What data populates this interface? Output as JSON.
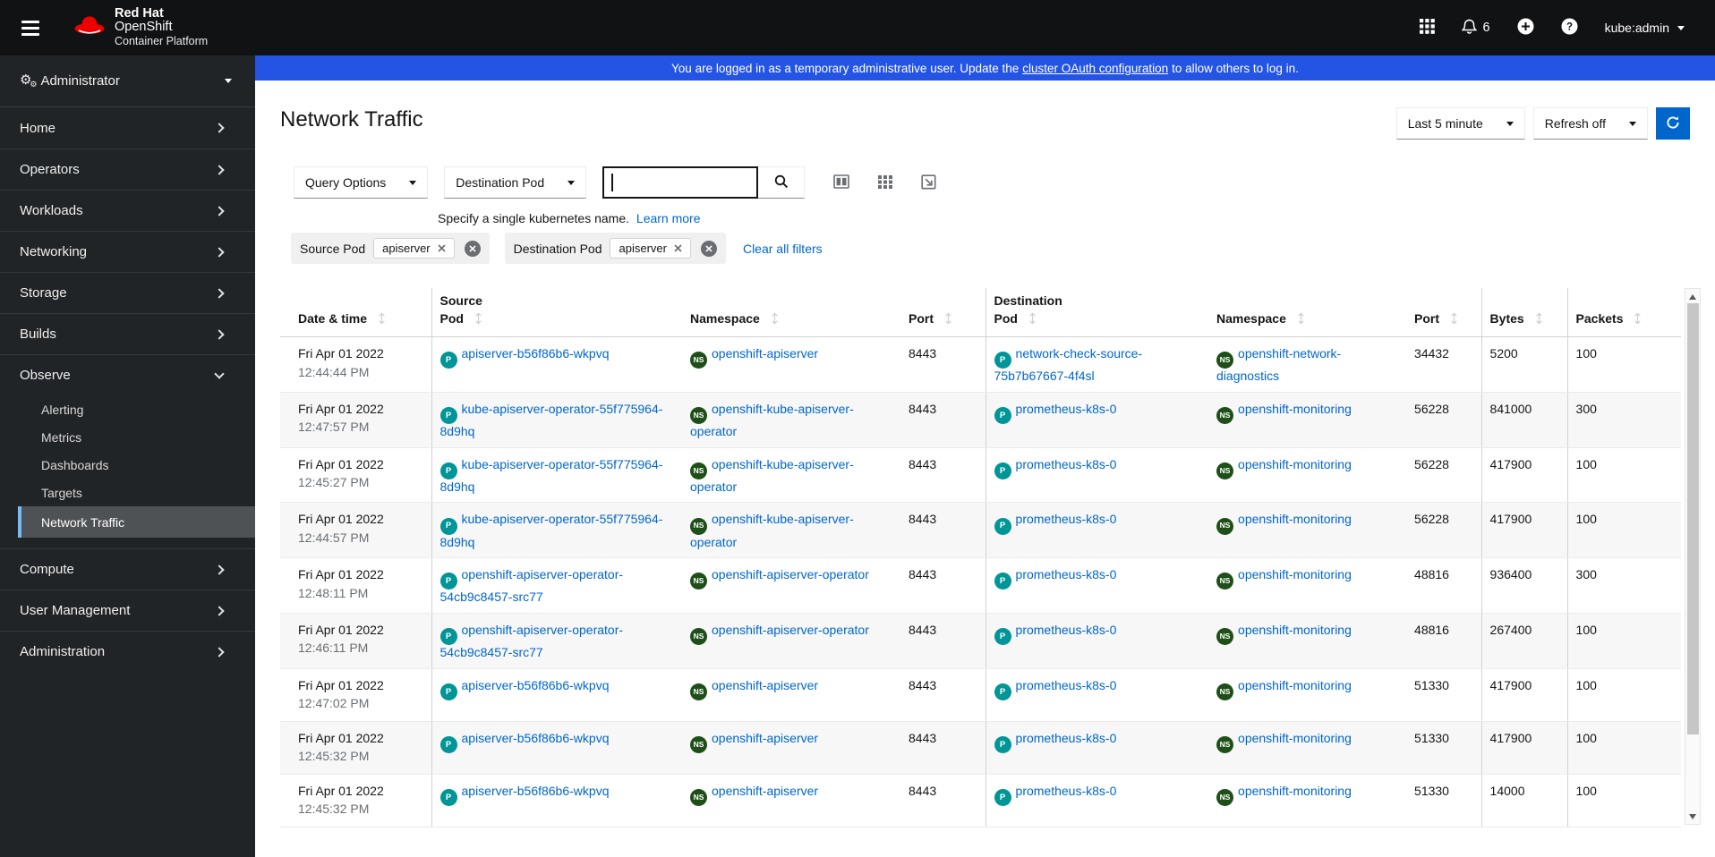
{
  "masthead": {
    "brand": {
      "line1": "Red Hat",
      "line2": "OpenShift",
      "line3": "Container Platform"
    },
    "notification_count": "6",
    "user": "kube:admin"
  },
  "banner": {
    "text_before": "You are logged in as a temporary administrative user. Update the",
    "link": "cluster OAuth configuration",
    "text_after": "to allow others to log in."
  },
  "sidebar": {
    "perspective": "Administrator",
    "top_items": [
      "Home",
      "Operators",
      "Workloads",
      "Networking",
      "Storage",
      "Builds"
    ],
    "observe_label": "Observe",
    "observe_children": [
      "Alerting",
      "Metrics",
      "Dashboards",
      "Targets",
      "Network Traffic"
    ],
    "active_item": "Network Traffic",
    "bottom_items": [
      "Compute",
      "User Management",
      "Administration"
    ]
  },
  "page": {
    "title": "Network Traffic"
  },
  "time_controls": {
    "range": "Last 5 minute",
    "refresh": "Refresh off"
  },
  "filter_bar": {
    "query_options": "Query Options",
    "filter_type": "Destination Pod",
    "search_value": "",
    "hint": "Specify a single kubernetes name.",
    "hint_link": "Learn more"
  },
  "filters": {
    "groups": [
      {
        "label": "Source Pod",
        "chip": "apiserver"
      },
      {
        "label": "Destination Pod",
        "chip": "apiserver"
      }
    ],
    "clear_all": "Clear all filters"
  },
  "badges": {
    "pod": "P",
    "namespace": "NS"
  },
  "table": {
    "group_headers": {
      "source": "Source",
      "destination": "Destination"
    },
    "columns": {
      "date": "Date & time",
      "pod": "Pod",
      "namespace": "Namespace",
      "port": "Port",
      "bytes": "Bytes",
      "packets": "Packets"
    },
    "rows": [
      {
        "date": "Fri Apr 01 2022",
        "time": "12:44:44 PM",
        "src_pod": "apiserver-b56f86b6-wkpvq",
        "src_ns": "openshift-apiserver",
        "src_port": "8443",
        "dst_pod": "network-check-source-75b7b67667-4f4sl",
        "dst_ns": "openshift-network-diagnostics",
        "dst_port": "34432",
        "bytes": "5200",
        "packets": "100"
      },
      {
        "date": "Fri Apr 01 2022",
        "time": "12:47:57 PM",
        "src_pod": "kube-apiserver-operator-55f775964-8d9hq",
        "src_ns": "openshift-kube-apiserver-operator",
        "src_port": "8443",
        "dst_pod": "prometheus-k8s-0",
        "dst_ns": "openshift-monitoring",
        "dst_port": "56228",
        "bytes": "841000",
        "packets": "300"
      },
      {
        "date": "Fri Apr 01 2022",
        "time": "12:45:27 PM",
        "src_pod": "kube-apiserver-operator-55f775964-8d9hq",
        "src_ns": "openshift-kube-apiserver-operator",
        "src_port": "8443",
        "dst_pod": "prometheus-k8s-0",
        "dst_ns": "openshift-monitoring",
        "dst_port": "56228",
        "bytes": "417900",
        "packets": "100"
      },
      {
        "date": "Fri Apr 01 2022",
        "time": "12:44:57 PM",
        "src_pod": "kube-apiserver-operator-55f775964-8d9hq",
        "src_ns": "openshift-kube-apiserver-operator",
        "src_port": "8443",
        "dst_pod": "prometheus-k8s-0",
        "dst_ns": "openshift-monitoring",
        "dst_port": "56228",
        "bytes": "417900",
        "packets": "100"
      },
      {
        "date": "Fri Apr 01 2022",
        "time": "12:48:11 PM",
        "src_pod": "openshift-apiserver-operator-54cb9c8457-src77",
        "src_ns": "openshift-apiserver-operator",
        "src_port": "8443",
        "dst_pod": "prometheus-k8s-0",
        "dst_ns": "openshift-monitoring",
        "dst_port": "48816",
        "bytes": "936400",
        "packets": "300"
      },
      {
        "date": "Fri Apr 01 2022",
        "time": "12:46:11 PM",
        "src_pod": "openshift-apiserver-operator-54cb9c8457-src77",
        "src_ns": "openshift-apiserver-operator",
        "src_port": "8443",
        "dst_pod": "prometheus-k8s-0",
        "dst_ns": "openshift-monitoring",
        "dst_port": "48816",
        "bytes": "267400",
        "packets": "100"
      },
      {
        "date": "Fri Apr 01 2022",
        "time": "12:47:02 PM",
        "src_pod": "apiserver-b56f86b6-wkpvq",
        "src_ns": "openshift-apiserver",
        "src_port": "8443",
        "dst_pod": "prometheus-k8s-0",
        "dst_ns": "openshift-monitoring",
        "dst_port": "51330",
        "bytes": "417900",
        "packets": "100"
      },
      {
        "date": "Fri Apr 01 2022",
        "time": "12:45:32 PM",
        "src_pod": "apiserver-b56f86b6-wkpvq",
        "src_ns": "openshift-apiserver",
        "src_port": "8443",
        "dst_pod": "prometheus-k8s-0",
        "dst_ns": "openshift-monitoring",
        "dst_port": "51330",
        "bytes": "417900",
        "packets": "100"
      },
      {
        "date": "Fri Apr 01 2022",
        "time": "12:45:32 PM",
        "src_pod": "apiserver-b56f86b6-wkpvq",
        "src_ns": "openshift-apiserver",
        "src_port": "8443",
        "dst_pod": "prometheus-k8s-0",
        "dst_ns": "openshift-monitoring",
        "dst_port": "51330",
        "bytes": "14000",
        "packets": "100"
      }
    ]
  },
  "colors": {
    "accent": "#0066cc",
    "banner_blue": "#2454e4",
    "pod_badge": "#009596",
    "namespace_badge": "#1e4f18",
    "masthead_bg": "#111214",
    "sidebar_bg": "#212427",
    "active_nav_bg": "#4f5255",
    "active_nav_bar": "#73bcf7",
    "brand_red": "#ee0000"
  }
}
